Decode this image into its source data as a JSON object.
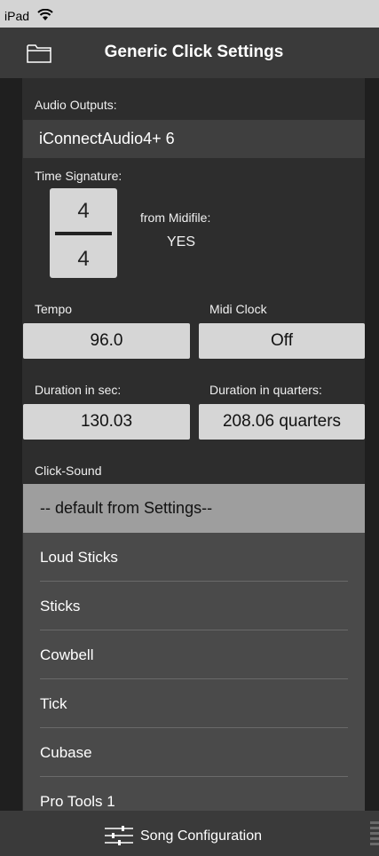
{
  "status": {
    "device": "iPad"
  },
  "nav": {
    "title": "Generic Click Settings"
  },
  "audio": {
    "label": "Audio Outputs:",
    "value": "iConnectAudio4+ 6"
  },
  "time_signature": {
    "label": "Time Signature:",
    "numerator": "4",
    "denominator": "4",
    "from_midi_label": "from Midifile:",
    "from_midi_value": "YES"
  },
  "tempo": {
    "label": "Tempo",
    "value": "96.0"
  },
  "midi_clock": {
    "label": "Midi Clock",
    "value": "Off"
  },
  "duration_sec": {
    "label": "Duration in sec:",
    "value": "130.03"
  },
  "duration_quarters": {
    "label": "Duration in quarters:",
    "value": "208.06 quarters"
  },
  "click_sound": {
    "label": "Click-Sound",
    "selected": "-- default from Settings--",
    "options": [
      "Loud Sticks",
      "Sticks",
      "Cowbell",
      "Tick",
      "Cubase",
      "Pro Tools 1"
    ]
  },
  "tab_bar": {
    "song_configuration_label": "Song Configuration"
  },
  "colors": {
    "background": "#1f1f1f",
    "panel": "#2d2d2d",
    "field": "#d6d6d6",
    "selected_row": "#9e9e9e"
  }
}
